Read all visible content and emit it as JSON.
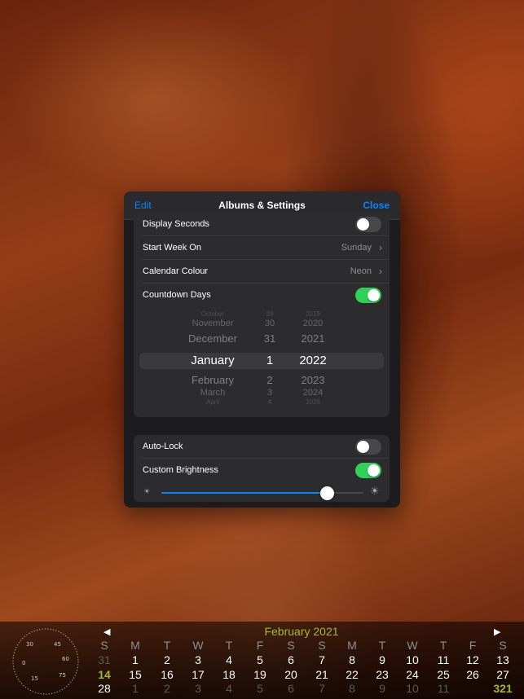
{
  "header": {
    "edit_label": "Edit",
    "title": "Albums & Settings",
    "close_label": "Close"
  },
  "settings": {
    "display_seconds": {
      "label": "Display Seconds",
      "on": false
    },
    "start_week_on": {
      "label": "Start Week On",
      "value": "Sunday"
    },
    "calendar_colour": {
      "label": "Calendar Colour",
      "value": "Neon"
    },
    "countdown_days": {
      "label": "Countdown Days",
      "on": true
    },
    "auto_lock": {
      "label": "Auto-Lock",
      "on": false
    },
    "custom_brightness": {
      "label": "Custom Brightness",
      "on": true
    },
    "brightness_level": 0.82
  },
  "date_picker": {
    "months": [
      "October",
      "November",
      "December",
      "January",
      "February",
      "March",
      "April"
    ],
    "days": [
      "29",
      "30",
      "31",
      "1",
      "2",
      "3",
      "4"
    ],
    "years": [
      "2019",
      "2020",
      "2021",
      "2022",
      "2023",
      "2024",
      "2025"
    ],
    "selected_index": 3
  },
  "calendar": {
    "title": "February 2021",
    "weekdays": [
      "S",
      "M",
      "T",
      "W",
      "T",
      "F",
      "S",
      "S",
      "M",
      "T",
      "W",
      "T",
      "F",
      "S"
    ],
    "rows": [
      [
        "31",
        "1",
        "2",
        "3",
        "4",
        "5",
        "6",
        "7",
        "8",
        "9",
        "10",
        "11",
        "12",
        "13"
      ],
      [
        "14",
        "15",
        "16",
        "17",
        "18",
        "19",
        "20",
        "21",
        "22",
        "23",
        "24",
        "25",
        "26",
        "27"
      ],
      [
        "28",
        "1",
        "2",
        "3",
        "4",
        "5",
        "6",
        "7",
        "8",
        "9",
        "10",
        "11",
        "321"
      ]
    ],
    "today": "14",
    "countdown": "321",
    "colors": {
      "accent": "#a4b82a",
      "toggle_on": "#30d158",
      "link": "#0a84ff"
    }
  },
  "clock_icon": "clock-face-icon"
}
